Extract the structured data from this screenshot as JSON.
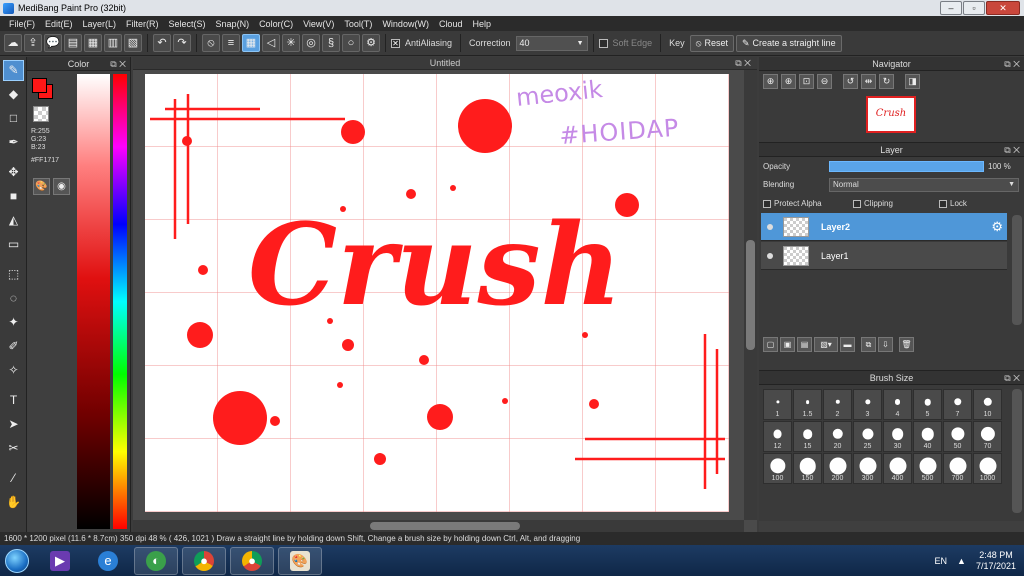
{
  "window": {
    "title": "MediBang Paint Pro (32bit)",
    "controls": [
      "–",
      "▫",
      "✕"
    ]
  },
  "menu": [
    "File(F)",
    "Edit(E)",
    "Layer(L)",
    "Filter(R)",
    "Select(S)",
    "Snap(N)",
    "Color(C)",
    "View(V)",
    "Tool(T)",
    "Window(W)",
    "Cloud",
    "Help"
  ],
  "toolbar": {
    "antialiasing_label": "AntiAliasing",
    "correction_label": "Correction",
    "correction_value": "40",
    "softedge_label": "Soft Edge",
    "key_label": "Key",
    "reset_label": "Reset",
    "straight_line_label": "Create a straight line"
  },
  "color_panel": {
    "title": "Color",
    "foreground_hex": "#FF1717",
    "r": "R:255",
    "g": "G:23",
    "b": "B:23",
    "hex_text": "#FF1717"
  },
  "document": {
    "tab_title": "Untitled",
    "main_text": "Crush",
    "handwriting_line1": "meoxik",
    "handwriting_line2": "#HOIDAP",
    "ink_color": "#ff1c1c",
    "handwriting_color": "#c58ae6"
  },
  "navigator": {
    "title": "Navigator",
    "thumb_text": "Crush"
  },
  "layer_panel": {
    "title": "Layer",
    "opacity_label": "Opacity",
    "opacity_value": "100 %",
    "opacity_fraction": 1.0,
    "blending_label": "Blending",
    "blending_value": "Normal",
    "protect_alpha": "Protect Alpha",
    "clipping": "Clipping",
    "lock": "Lock",
    "layers": [
      {
        "name": "Layer2",
        "selected": true
      },
      {
        "name": "Layer1",
        "selected": false
      }
    ]
  },
  "brush_size": {
    "title": "Brush Size",
    "sizes": [
      "1",
      "1.5",
      "2",
      "3",
      "4",
      "5",
      "7",
      "10",
      "12",
      "15",
      "20",
      "25",
      "30",
      "40",
      "50",
      "70",
      "100",
      "150",
      "200",
      "300",
      "400",
      "500",
      "700",
      "1000"
    ]
  },
  "status": {
    "text": "1600 * 1200 pixel   (11.6 * 8.7cm)   350 dpi   48 %   ( 426, 1021 )   Draw a straight line by holding down Shift, Change a brush size by holding down Ctrl, Alt, and dragging"
  },
  "taskbar": {
    "lang": "EN",
    "time": "2:48 PM",
    "date": "7/17/2021"
  }
}
